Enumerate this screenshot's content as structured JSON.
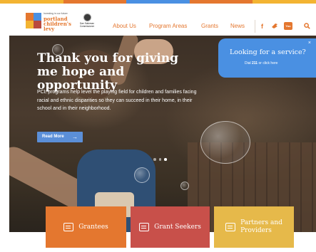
{
  "top_stripe_colors": [
    "#f3b432",
    "#e4772f",
    "#4a90e2",
    "#e4772f",
    "#f3b432"
  ],
  "logo": {
    "tagline": "Investing in our future",
    "name_lines": [
      "portland",
      "children's",
      "levy"
    ],
    "mark_colors": [
      "#e4772f",
      "#4a90e2",
      "#f3b432",
      "#b94a3e"
    ]
  },
  "commissioner": {
    "name": "Dan Saltzman",
    "title": "Commissioner"
  },
  "nav": {
    "items": [
      "About Us",
      "Program Areas",
      "Grants",
      "News"
    ],
    "social": {
      "facebook": "f",
      "twitter_icon": "bird-icon",
      "youtube": "You Tube",
      "search_icon": "search-icon"
    }
  },
  "hero": {
    "title": "Thank you for giving me hope and opportunity",
    "text": "PCL programs help level the playing field for children and families facing racial and ethnic disparities so they can succeed in their home, in their school and in their neighborhood.",
    "button": "Read More",
    "slides": 3,
    "active_slide": 3
  },
  "service_callout": {
    "title": "Looking for a service?",
    "subtitle_pre": "Dial ",
    "subtitle_number": "211",
    "subtitle_post": " or click here",
    "close": "×"
  },
  "cards": [
    {
      "label": "Grantees",
      "label_line2": "",
      "color": "#e4772f",
      "icon": "document-icon"
    },
    {
      "label": "Grant Seekers",
      "label_line2": "",
      "color": "#c8504a",
      "icon": "hand-icon"
    },
    {
      "label": "Partners and",
      "label_line2": "Providers",
      "color": "#e6b94a",
      "icon": "handshake-icon"
    }
  ],
  "colors": {
    "accent": "#e4772f",
    "blue": "#4a90e2"
  }
}
